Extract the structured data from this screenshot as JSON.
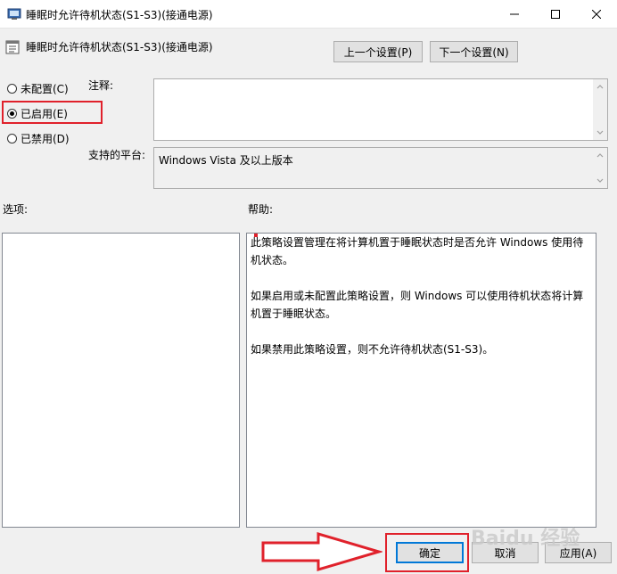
{
  "window": {
    "title": "睡眠时允许待机状态(S1-S3)(接通电源)",
    "controls": {
      "minimize": "minimize-icon",
      "maximize": "maximize-icon",
      "close": "close-icon"
    }
  },
  "header": {
    "title": "睡眠时允许待机状态(S1-S3)(接通电源)",
    "prev_button": "上一个设置(P)",
    "next_button": "下一个设置(N)"
  },
  "state_options": [
    {
      "label": "未配置(C)",
      "checked": false
    },
    {
      "label": "已启用(E)",
      "checked": true
    },
    {
      "label": "已禁用(D)",
      "checked": false
    }
  ],
  "comment": {
    "label": "注释:",
    "value": ""
  },
  "platform": {
    "label": "支持的平台:",
    "value": "Windows Vista 及以上版本"
  },
  "options": {
    "label": "选项:"
  },
  "help": {
    "label": "帮助:",
    "paragraphs": [
      "此策略设置管理在将计算机置于睡眠状态时是否允许 Windows 使用待机状态。",
      "如果启用或未配置此策略设置，则 Windows 可以使用待机状态将计算机置于睡眠状态。",
      "如果禁用此策略设置，则不允许待机状态(S1-S3)。"
    ]
  },
  "footer": {
    "ok_button": "确定",
    "cancel_button": "取消",
    "apply_button": "应用(A)"
  },
  "watermark": "Baidu 经验",
  "colors": {
    "highlight": "#e0212b",
    "accent": "#0078d7"
  }
}
